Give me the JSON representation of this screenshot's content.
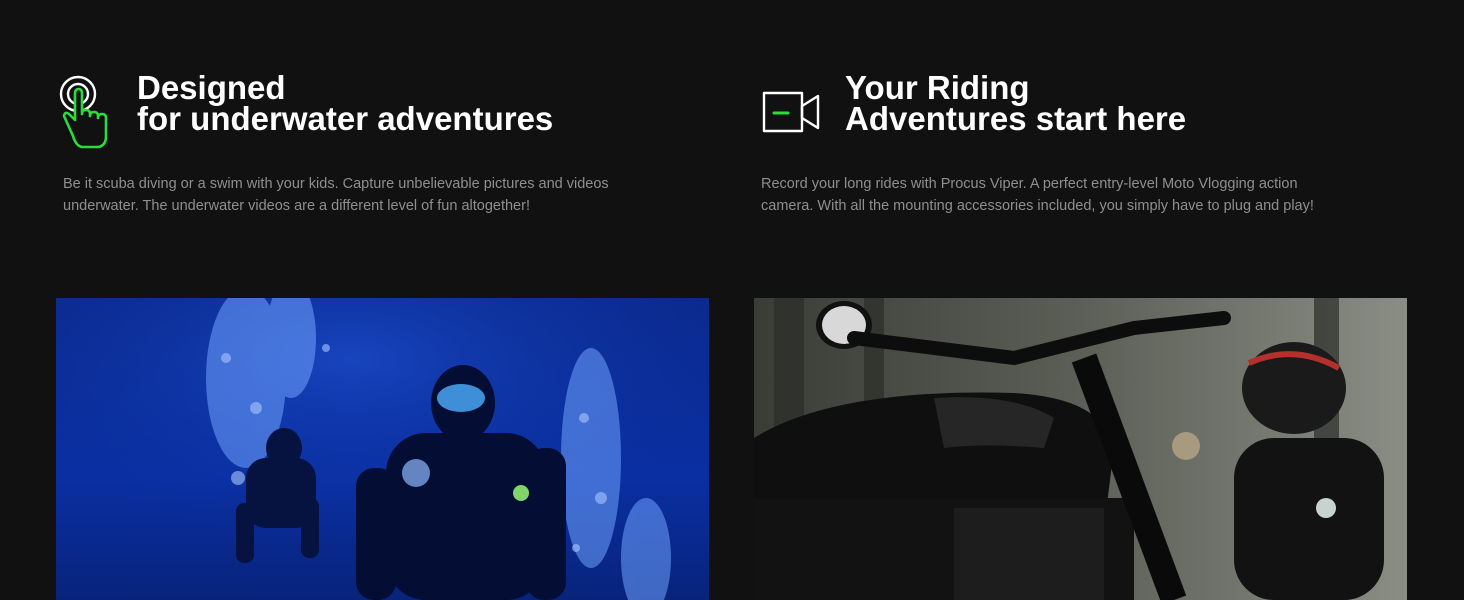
{
  "features": [
    {
      "title_line1": "Designed",
      "title_line2": "for underwater adventures",
      "description_line1": "Be it scuba diving or a swim with your kids. Capture unbelievable pictures and videos",
      "description_line2": "underwater. The underwater videos are a different level of fun altogether!",
      "icon": "touch-hand-icon"
    },
    {
      "title_line1": "Your Riding",
      "title_line2": "Adventures start here",
      "description_line1": "Record your long rides with Procus Viper. A perfect entry-level Moto Vlogging action",
      "description_line2": "camera. With all the mounting accessories included, you simply have to plug and play!",
      "icon": "video-camera-icon"
    }
  ],
  "colors": {
    "background": "#111111",
    "accent": "#2bdc3c",
    "title": "#ffffff",
    "text": "#8f8f8f"
  }
}
